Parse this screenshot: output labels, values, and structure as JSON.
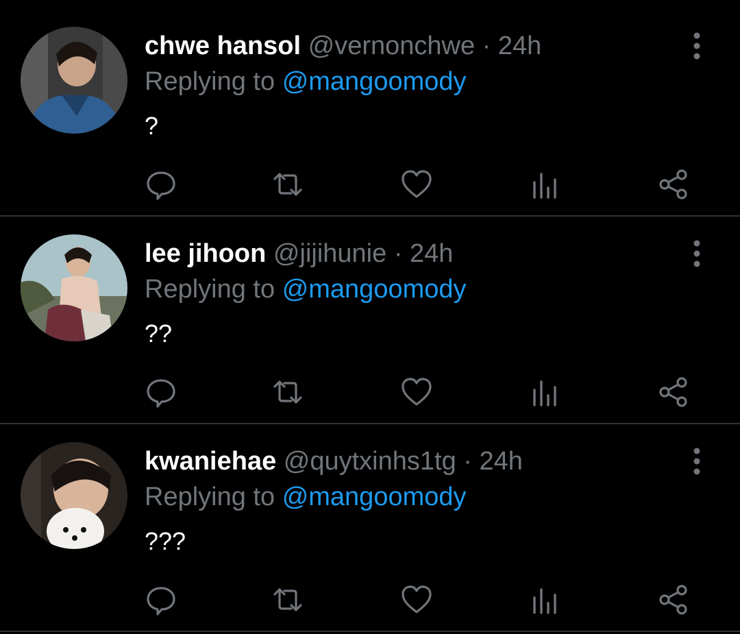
{
  "tweets": [
    {
      "name": "chwe hansol",
      "handle": "@vernonchwe",
      "separator": "·",
      "time": "24h",
      "replying_prefix": "Replying to",
      "replying_to": "@mangoomody",
      "text": "?"
    },
    {
      "name": "lee jihoon",
      "handle": "@jijihunie",
      "separator": "·",
      "time": "24h",
      "replying_prefix": "Replying to",
      "replying_to": "@mangoomody",
      "text": "??"
    },
    {
      "name": "kwaniehae",
      "handle": "@quytxinhs1tg",
      "separator": "·",
      "time": "24h",
      "replying_prefix": "Replying to",
      "replying_to": "@mangoomody",
      "text": "???"
    }
  ],
  "icons": {
    "reply": "reply-icon",
    "retweet": "retweet-icon",
    "like": "heart-icon",
    "views": "views-icon",
    "share": "share-icon",
    "more": "more-vertical-icon"
  },
  "colors": {
    "background": "#000000",
    "text": "#ffffff",
    "muted": "#71767b",
    "link": "#1d9bf0",
    "divider": "#2f3336"
  }
}
